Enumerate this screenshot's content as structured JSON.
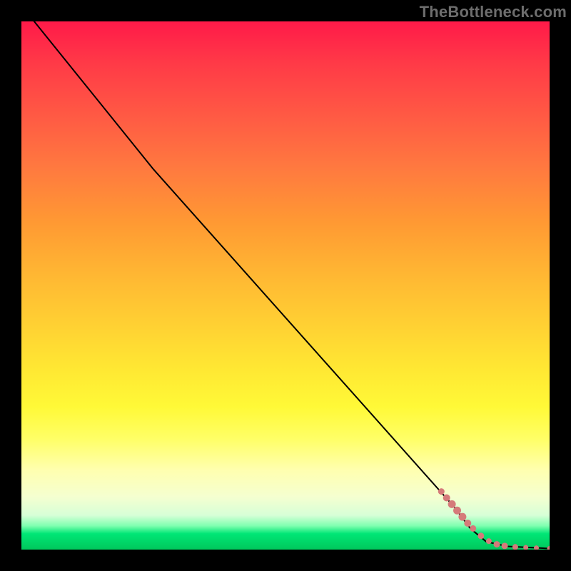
{
  "watermark": "TheBottleneck.com",
  "colors": {
    "curve": "#000000",
    "marker_fill": "#d57a7a",
    "marker_stroke": "#b55a5a"
  },
  "chart_data": {
    "type": "line",
    "title": "",
    "xlabel": "",
    "ylabel": "",
    "xlim": [
      0,
      100
    ],
    "ylim": [
      0,
      100
    ],
    "curve": [
      {
        "x": 0,
        "y": 103
      },
      {
        "x": 25,
        "y": 72
      },
      {
        "x": 82,
        "y": 8
      },
      {
        "x": 85,
        "y": 4
      },
      {
        "x": 88,
        "y": 1.5
      },
      {
        "x": 92,
        "y": 0.6
      },
      {
        "x": 100,
        "y": 0.2
      }
    ],
    "markers": [
      {
        "x": 79.5,
        "y": 11.0,
        "r": 4.5
      },
      {
        "x": 80.5,
        "y": 9.8,
        "r": 5.0
      },
      {
        "x": 81.5,
        "y": 8.6,
        "r": 5.5
      },
      {
        "x": 82.5,
        "y": 7.4,
        "r": 5.5
      },
      {
        "x": 83.5,
        "y": 6.2,
        "r": 5.5
      },
      {
        "x": 84.5,
        "y": 5.0,
        "r": 5.0
      },
      {
        "x": 85.5,
        "y": 4.0,
        "r": 4.5
      },
      {
        "x": 87.0,
        "y": 2.6,
        "r": 4.5
      },
      {
        "x": 88.5,
        "y": 1.6,
        "r": 4.0
      },
      {
        "x": 90.0,
        "y": 1.0,
        "r": 4.5
      },
      {
        "x": 91.5,
        "y": 0.7,
        "r": 4.5
      },
      {
        "x": 93.5,
        "y": 0.5,
        "r": 4.0
      },
      {
        "x": 95.5,
        "y": 0.4,
        "r": 3.5
      },
      {
        "x": 97.5,
        "y": 0.3,
        "r": 3.5
      },
      {
        "x": 100,
        "y": 0.2,
        "r": 3.5
      }
    ]
  }
}
